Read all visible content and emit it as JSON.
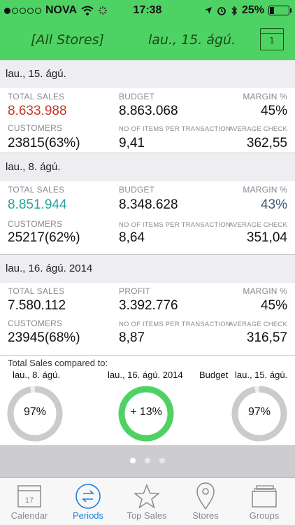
{
  "status_bar": {
    "carrier": "NOVA",
    "time": "17:38",
    "battery": "25%",
    "battery_level": 0.25
  },
  "nav": {
    "store": "[All Stores]",
    "date": "lau., 15. ágú.",
    "calendar_day": "1"
  },
  "colors": {
    "accent": "#4fd264",
    "red": "#c0392b",
    "teal": "#2aa198",
    "blue": "#1a7fe0"
  },
  "sections": [
    {
      "header": "lau., 15. ágú.",
      "total_sales_label": "TOTAL SALES",
      "total_sales": "8.633.988",
      "mid_label": "BUDGET",
      "mid_value": "8.863.068",
      "margin_label": "MARGIN %",
      "margin": "45%",
      "customers_label": "CUSTOMERS",
      "customers": "23815(63%)",
      "items_label": "NO OF ITEMS PER TRANSACTION",
      "items": "9,41",
      "avg_label": "AVERAGE CHECK",
      "avg": "362,55"
    },
    {
      "header": "lau., 8. ágú.",
      "total_sales_label": "TOTAL SALES",
      "total_sales": "8.851.944",
      "mid_label": "BUDGET",
      "mid_value": "8.348.628",
      "margin_label": "MARGIN %",
      "margin": "43%",
      "customers_label": "CUSTOMERS",
      "customers": "25217(62%)",
      "items_label": "NO OF ITEMS PER TRANSACTION",
      "items": "8,64",
      "avg_label": "AVERAGE CHECK",
      "avg": "351,04"
    },
    {
      "header": "lau., 16. ágú. 2014",
      "total_sales_label": "TOTAL SALES",
      "total_sales": "7.580.112",
      "mid_label": "PROFIT",
      "mid_value": "3.392.776",
      "margin_label": "MARGIN %",
      "margin": "45%",
      "customers_label": "CUSTOMERS",
      "customers": "23945(68%)",
      "items_label": "NO OF ITEMS PER TRANSACTION",
      "items": "8,87",
      "avg_label": "AVERAGE CHECK",
      "avg": "316,57"
    }
  ],
  "compare": {
    "title": "Total Sales compared to:",
    "labels": [
      "lau., 8. ágú.",
      "lau., 16. ágú. 2014",
      "Budget",
      "lau., 15. ágú."
    ],
    "gauges": [
      {
        "text": "97%",
        "fraction": 0.97,
        "color": "#c9cbcd"
      },
      {
        "text": "+ 13%",
        "fraction": 1.0,
        "color": "#4fd264"
      },
      {
        "text": "97%",
        "fraction": 0.97,
        "color": "#c9cbcd"
      }
    ]
  },
  "pager": {
    "pages": 3,
    "active": 0
  },
  "tabs": [
    {
      "label": "Calendar",
      "icon": "calendar-icon",
      "day": "17"
    },
    {
      "label": "Periods",
      "icon": "periods-icon",
      "active": true
    },
    {
      "label": "Top Sales",
      "icon": "star-icon"
    },
    {
      "label": "Stores",
      "icon": "map-pin-icon"
    },
    {
      "label": "Groups",
      "icon": "groups-icon"
    }
  ]
}
